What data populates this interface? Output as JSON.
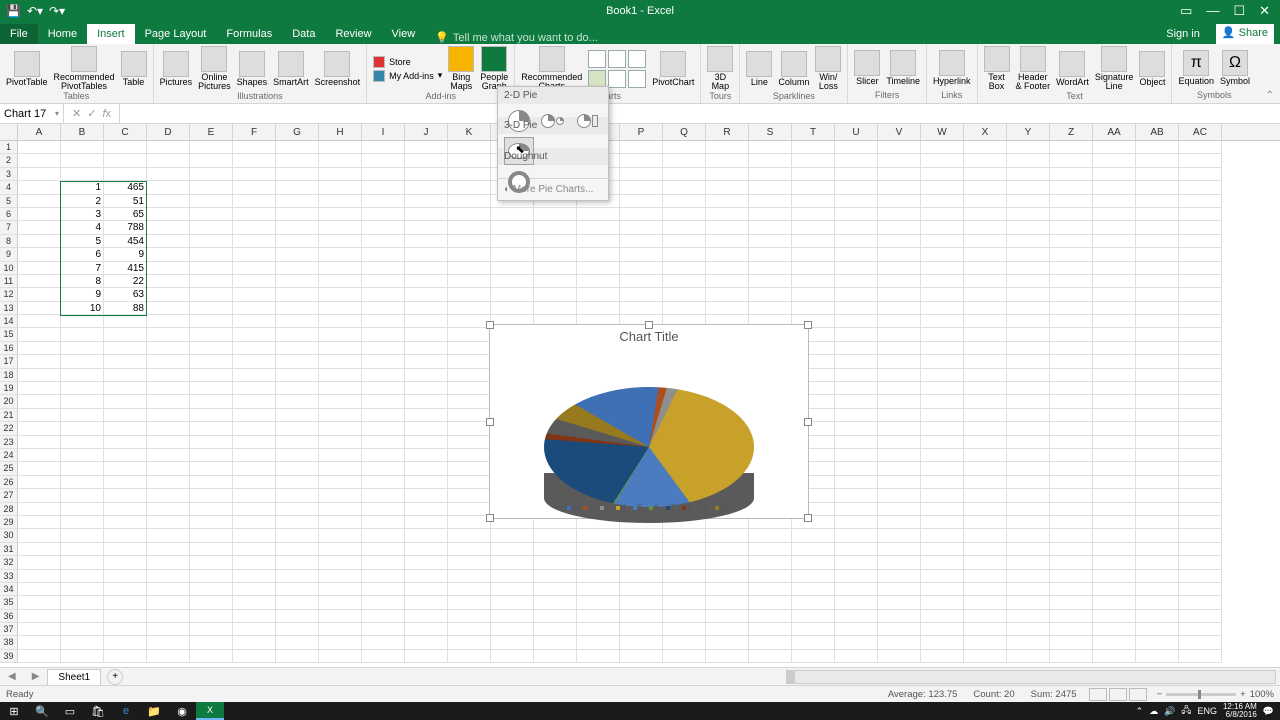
{
  "window": {
    "title": "Book1 - Excel"
  },
  "tabs": {
    "file": "File",
    "home": "Home",
    "insert": "Insert",
    "page_layout": "Page Layout",
    "formulas": "Formulas",
    "data": "Data",
    "review": "Review",
    "view": "View",
    "tell_me": "Tell me what you want to do...",
    "sign_in": "Sign in",
    "share": "Share"
  },
  "ribbon": {
    "pivot_table": "PivotTable",
    "rec_pivot": "Recommended\nPivotTables",
    "table": "Table",
    "tables_grp": "Tables",
    "pictures": "Pictures",
    "online_pictures": "Online\nPictures",
    "shapes": "Shapes",
    "smartart": "SmartArt",
    "screenshot": "Screenshot",
    "illustrations_grp": "Illustrations",
    "store": "Store",
    "my_addins": "My Add-ins",
    "bing": "Bing\nMaps",
    "people": "People\nGraph",
    "addins_grp": "Add-ins",
    "rec_charts": "Recommended\nCharts",
    "pivotchart": "PivotChart",
    "charts_grp": "Charts",
    "map3d": "3D\nMap",
    "tours_grp": "Tours",
    "line": "Line",
    "column": "Column",
    "winloss": "Win/\nLoss",
    "sparklines_grp": "Sparklines",
    "slicer": "Slicer",
    "timeline": "Timeline",
    "filters_grp": "Filters",
    "hyperlink": "Hyperlink",
    "links_grp": "Links",
    "textbox": "Text\nBox",
    "headerfooter": "Header\n& Footer",
    "wordart": "WordArt",
    "sigline": "Signature\nLine",
    "object": "Object",
    "text_grp": "Text",
    "equation": "Equation",
    "symbol": "Symbol",
    "symbols_grp": "Symbols"
  },
  "pie_menu": {
    "two_d": "2-D Pie",
    "three_d": "3-D Pie",
    "doughnut": "Doughnut",
    "more": "More Pie Charts..."
  },
  "namebox": "Chart 17",
  "columns": [
    "A",
    "B",
    "C",
    "D",
    "E",
    "F",
    "G",
    "H",
    "I",
    "J",
    "K",
    "L",
    "N",
    "O",
    "P",
    "Q",
    "R",
    "S",
    "T",
    "U",
    "V",
    "W",
    "X",
    "Y",
    "Z",
    "AA",
    "AB",
    "AC"
  ],
  "row_count": 39,
  "cell_data": {
    "r4": {
      "b": "1",
      "c": "465"
    },
    "r5": {
      "b": "2",
      "c": "51"
    },
    "r6": {
      "b": "3",
      "c": "65"
    },
    "r7": {
      "b": "4",
      "c": "788"
    },
    "r8": {
      "b": "5",
      "c": "454"
    },
    "r9": {
      "b": "6",
      "c": "9"
    },
    "r10": {
      "b": "7",
      "c": "415"
    },
    "r11": {
      "b": "8",
      "c": "22"
    },
    "r12": {
      "b": "9",
      "c": "63"
    },
    "r13": {
      "b": "10",
      "c": "88"
    }
  },
  "chart_data": {
    "type": "pie",
    "title": "Chart Title",
    "categories": [
      "1",
      "2",
      "3",
      "4",
      "5",
      "6",
      "7",
      "8",
      "9",
      "10"
    ],
    "values": [
      465,
      51,
      65,
      788,
      454,
      9,
      415,
      22,
      63,
      88
    ],
    "colors": [
      "#3f6fb5",
      "#b04d1e",
      "#8f8f8f",
      "#c8a12a",
      "#4c7bc0",
      "#5c9442",
      "#1b4b7a",
      "#803515",
      "#5a5a5a",
      "#97791e"
    ]
  },
  "sheet_tab": "Sheet1",
  "status": {
    "ready": "Ready",
    "avg": "Average: 123.75",
    "count": "Count: 20",
    "sum": "Sum: 2475",
    "zoom": "100%"
  },
  "tray": {
    "lang": "ENG",
    "time": "12:16 AM",
    "date": "6/8/2016"
  }
}
